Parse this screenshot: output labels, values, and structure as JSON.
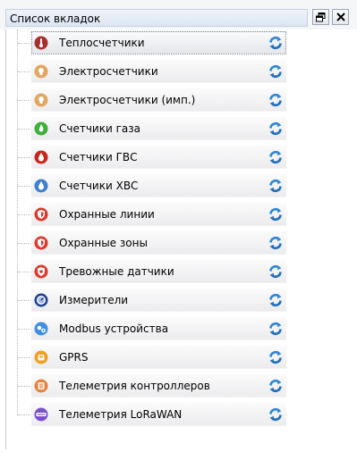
{
  "panel": {
    "title": "Список вкладок"
  },
  "header_buttons": [
    {
      "name": "restore-window-icon"
    },
    {
      "name": "close-icon"
    }
  ],
  "tabs": [
    {
      "label": "Теплосчетчики",
      "icon": "thermometer-icon",
      "color": "#a8302c",
      "selected": true
    },
    {
      "label": "Электросчетчики",
      "icon": "lightbulb-icon",
      "color": "#e3a660",
      "selected": false
    },
    {
      "label": "Электросчетчики (имп.)",
      "icon": "lightbulb-icon",
      "color": "#e3a660",
      "selected": false
    },
    {
      "label": "Счетчики газа",
      "icon": "gas-flame-icon",
      "color": "#3fae3a",
      "selected": false
    },
    {
      "label": "Счетчики ГВС",
      "icon": "hot-water-drop-icon",
      "color": "#c8271f",
      "selected": false
    },
    {
      "label": "Счетчики ХВС",
      "icon": "cold-water-drop-icon",
      "color": "#3f7fd0",
      "selected": false
    },
    {
      "label": "Охранные линии",
      "icon": "security-shield-icon",
      "color": "#e2352a",
      "selected": false
    },
    {
      "label": "Охранные зоны",
      "icon": "security-shield-icon",
      "color": "#e2352a",
      "selected": false
    },
    {
      "label": "Тревожные датчики",
      "icon": "alarm-shield-icon",
      "color": "#e2352a",
      "selected": false
    },
    {
      "label": "Измерители",
      "icon": "meter-gauge-icon",
      "color": "#1f3f8f",
      "selected": false
    },
    {
      "label": "Modbus устройства",
      "icon": "modbus-device-icon",
      "color": "#3f8fe0",
      "selected": false
    },
    {
      "label": "GPRS",
      "icon": "gprs-modem-icon",
      "color": "#f0a020",
      "selected": false
    },
    {
      "label": "Телеметрия контроллеров",
      "icon": "controller-icon",
      "color": "#e8823a",
      "selected": false
    },
    {
      "label": "Телеметрия LoRaWAN",
      "icon": "lorawan-icon",
      "color": "#7a4fd0",
      "selected": false
    }
  ],
  "refresh_icon": "refresh-icon"
}
